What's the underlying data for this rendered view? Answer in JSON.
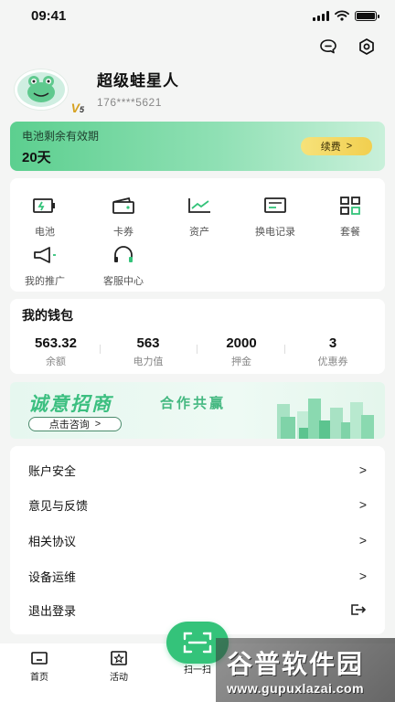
{
  "status_bar": {
    "time": "09:41"
  },
  "profile": {
    "name": "超级蛙星人",
    "phone": "176****5621",
    "vip_badge": "V",
    "vip_level": "5"
  },
  "battery_card": {
    "label": "电池剩余有效期",
    "days": "20天",
    "renew_label": "续费",
    "renew_arrow": ">"
  },
  "menu": [
    {
      "label": "电池",
      "icon": "battery-icon"
    },
    {
      "label": "卡券",
      "icon": "wallet-icon"
    },
    {
      "label": "资产",
      "icon": "asset-chart-icon"
    },
    {
      "label": "换电记录",
      "icon": "record-icon"
    },
    {
      "label": "套餐",
      "icon": "package-grid-icon"
    },
    {
      "label": "我的推广",
      "icon": "megaphone-icon"
    },
    {
      "label": "客服中心",
      "icon": "headset-icon"
    }
  ],
  "wallet": {
    "title": "我的钱包",
    "stats": [
      {
        "value": "563.32",
        "label": "余额"
      },
      {
        "value": "563",
        "label": "电力值"
      },
      {
        "value": "2000",
        "label": "押金"
      },
      {
        "value": "3",
        "label": "优惠券"
      }
    ]
  },
  "banner": {
    "title": "诚意招商",
    "subtitle": "合作共赢",
    "button_label": "点击咨询",
    "button_arrow": ">"
  },
  "settings_list": [
    {
      "label": "账户安全",
      "trailing": ">"
    },
    {
      "label": "意见与反馈",
      "trailing": ">"
    },
    {
      "label": "相关协议",
      "trailing": ">"
    },
    {
      "label": "设备运维",
      "trailing": ">"
    },
    {
      "label": "退出登录",
      "trailing": "logout-icon"
    }
  ],
  "tabbar": {
    "home": "首页",
    "activity": "活动",
    "scan": "扫一扫"
  },
  "watermark": {
    "title": "谷普软件园",
    "url": "www.gupuxlazai.com"
  },
  "colors": {
    "accent": "#34c37a",
    "renew": "#f2cf4f",
    "background": "#f4f5f4"
  }
}
